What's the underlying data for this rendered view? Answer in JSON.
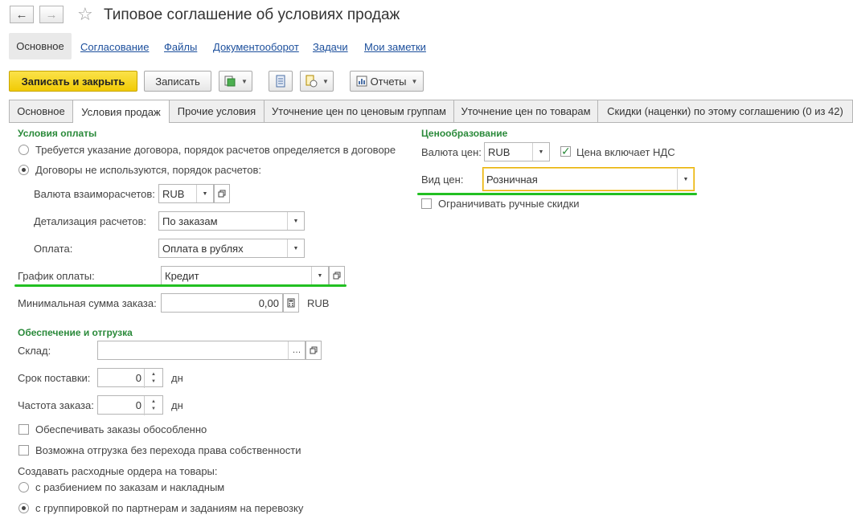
{
  "window": {
    "title": "Типовое соглашение об условиях продаж",
    "back_icon": "←",
    "forward_icon": "→",
    "star_icon": "☆"
  },
  "nav": {
    "main": "Основное",
    "links": [
      "Согласование",
      "Файлы",
      "Документооборот",
      "Задачи",
      "Мои заметки"
    ]
  },
  "toolbar": {
    "save_close": "Записать и закрыть",
    "save": "Записать",
    "reports": "Отчеты"
  },
  "tabs": [
    "Основное",
    "Условия продаж",
    "Прочие условия",
    "Уточнение цен по ценовым группам",
    "Уточнение цен по товарам",
    "Скидки (наценки) по этому соглашению (0 из 42)"
  ],
  "payment": {
    "section": "Условия оплаты",
    "radio1": "Требуется указание договора, порядок расчетов определяется в договоре",
    "radio2": "Договоры не используются, порядок расчетов:",
    "currency_label": "Валюта взаиморасчетов:",
    "currency_value": "RUB",
    "detail_label": "Детализация расчетов:",
    "detail_value": "По заказам",
    "pay_label": "Оплата:",
    "pay_value": "Оплата в рублях",
    "schedule_label": "График оплаты:",
    "schedule_value": "Кредит",
    "minsum_label": "Минимальная сумма заказа:",
    "minsum_value": "0,00",
    "minsum_currency": "RUB"
  },
  "shipping": {
    "section": "Обеспечение и отгрузка",
    "warehouse_label": "Склад:",
    "warehouse_value": "",
    "term_label": "Срок поставки:",
    "term_value": "0",
    "term_unit": "дн",
    "freq_label": "Частота заказа:",
    "freq_value": "0",
    "freq_unit": "дн",
    "chk1": "Обеспечивать заказы обособленно",
    "chk2": "Возможна отгрузка без перехода права собственности",
    "orders_label": "Создавать расходные ордера на товары:",
    "radio_a": "с разбиением по заказам и накладным",
    "radio_b": "с группировкой по партнерам и заданиям на перевозку"
  },
  "pricing": {
    "section": "Ценообразование",
    "currency_label": "Валюта цен:",
    "currency_value": "RUB",
    "vat_label": "Цена включает НДС",
    "type_label": "Вид цен:",
    "type_value": "Розничная",
    "limit_label": "Ограничивать ручные скидки"
  },
  "colors": {
    "accent_green": "#22c022",
    "primary_button": "#f1cb05",
    "link": "#1c4f9c"
  }
}
